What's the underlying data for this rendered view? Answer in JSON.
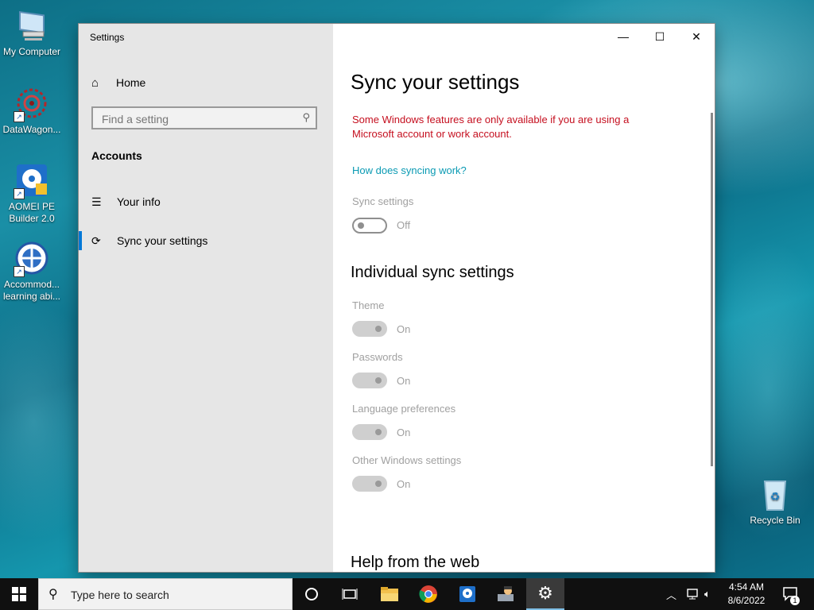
{
  "desktop": {
    "icons": [
      {
        "label": "My Computer",
        "icon": "computer-icon"
      },
      {
        "label": "DataWagon...",
        "icon": "datawagon-icon"
      },
      {
        "label": "AOMEI PE Builder 2.0",
        "icon": "aomei-icon"
      },
      {
        "label": "Accommod... learning abi...",
        "icon": "accommodation-icon"
      },
      {
        "label": "Recycle Bin",
        "icon": "recycle-bin-icon"
      }
    ]
  },
  "window": {
    "title": "Settings",
    "controls": {
      "minimize": "—",
      "maximize": "☐",
      "close": "✕"
    }
  },
  "sidebar": {
    "home_label": "Home",
    "search_placeholder": "Find a setting",
    "section": "Accounts",
    "items": [
      {
        "label": "Your info",
        "icon": "person-info-icon"
      },
      {
        "label": "Sync your settings",
        "icon": "sync-icon",
        "active": true
      }
    ]
  },
  "main": {
    "title": "Sync your settings",
    "warning": "Some Windows features are only available if you are using a Microsoft account or work account.",
    "link": "How does syncing work?",
    "sync_label": "Sync settings",
    "sync_state": "Off",
    "individual_title": "Individual sync settings",
    "individual": [
      {
        "label": "Theme",
        "state": "On"
      },
      {
        "label": "Passwords",
        "state": "On"
      },
      {
        "label": "Language preferences",
        "state": "On"
      },
      {
        "label": "Other Windows settings",
        "state": "On"
      }
    ],
    "help_title": "Help from the web"
  },
  "taskbar": {
    "search_placeholder": "Type here to search",
    "time": "4:54 AM",
    "date": "8/6/2022",
    "notification_count": "1",
    "accent": "#0078d7"
  }
}
